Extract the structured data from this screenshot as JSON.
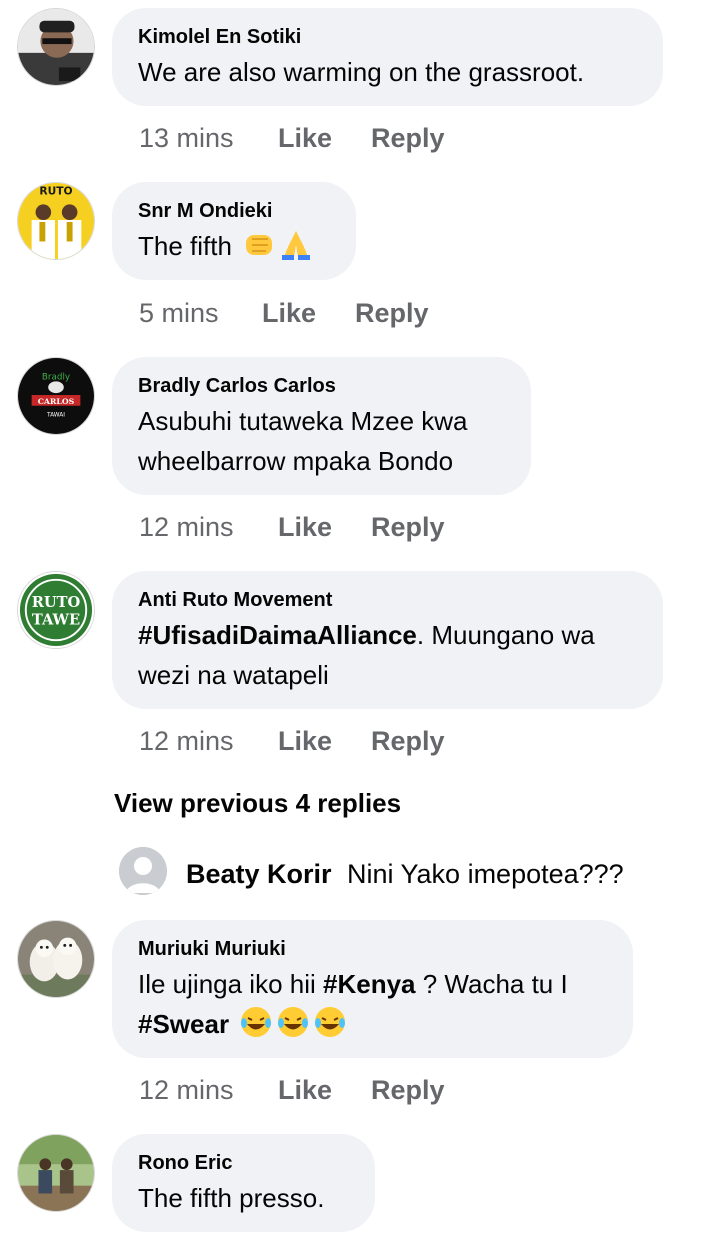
{
  "comments": [
    {
      "author": "Kimolel En Sotiki",
      "text": "We are also warming on the grassroot.",
      "time": "13 mins",
      "like": "Like",
      "reply": "Reply",
      "avatar": "profile-photo"
    },
    {
      "author": "Snr M Ondieki",
      "text": "The fifth",
      "emojis": [
        "oncoming-fist-emoji",
        "folded-hands-emoji"
      ],
      "time": "5 mins",
      "like": "Like",
      "reply": "Reply",
      "avatar_text": "RUTO"
    },
    {
      "author": "Bradly Carlos Carlos",
      "text_lines": [
        "Asubuhi tutaweka Mzee kwa",
        "wheelbarrow mpaka Bondo"
      ],
      "time": "12 mins",
      "like": "Like",
      "reply": "Reply",
      "avatar_text": [
        "Bradly",
        "CARLOS",
        "TAWAI"
      ]
    },
    {
      "author": "Anti Ruto Movement",
      "hashtag": "#UfisadiDaimaAlliance",
      "text_line1_rest": ". Muungano wa",
      "text_line2": "wezi na watapeli",
      "time": "12 mins",
      "like": "Like",
      "reply": "Reply",
      "avatar_text": [
        "RUTO",
        "TAWE"
      ]
    },
    {
      "author": "Muriuki Muriuki",
      "line1_a": "Ile ujinga iko hii ",
      "line1_tag": "#Kenya",
      "line1_b": " ? Wacha tu I",
      "line2_tag": "#Swear",
      "emojis": [
        "laughing-tears-emoji",
        "laughing-tears-emoji",
        "laughing-tears-emoji"
      ],
      "time": "12 mins",
      "like": "Like",
      "reply": "Reply",
      "avatar": "dogs-photo"
    },
    {
      "author": "Rono Eric",
      "text": "The fifth presso.",
      "avatar": "outdoor-photo"
    }
  ],
  "view_previous": "View previous 4 replies",
  "reply_preview": {
    "author": "Beaty Korir",
    "text": "Nini Yako imepotea???"
  },
  "colors": {
    "bubble": "#f0f2f5",
    "meta": "#65676b",
    "text": "#050505",
    "ruto_yellow": "#f5d020",
    "ruto_green": "#2e7d32"
  }
}
